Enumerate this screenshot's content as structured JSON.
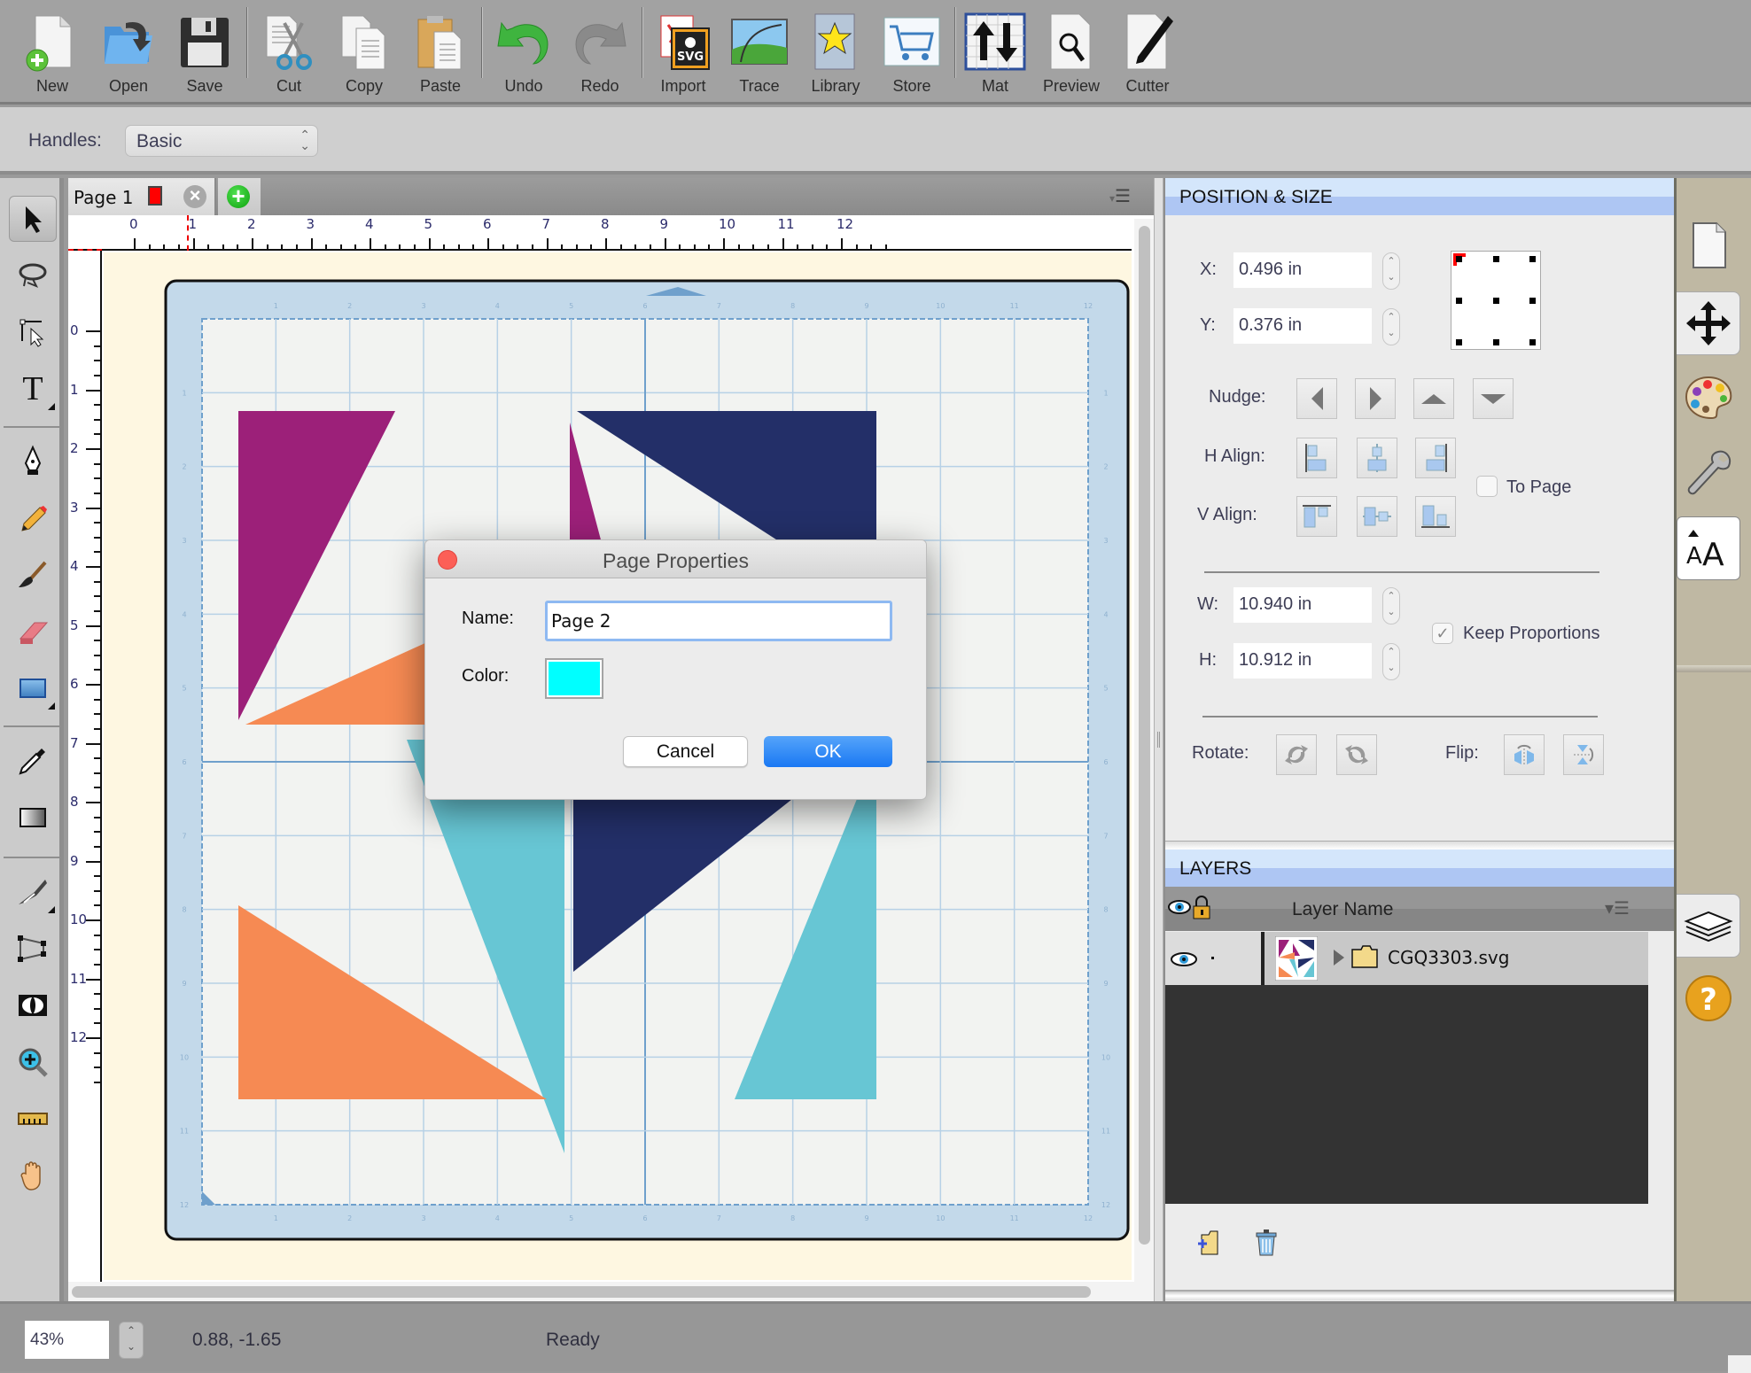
{
  "toolbar": {
    "buttons": [
      {
        "id": "new",
        "label": "New",
        "icon": "new-document-icon"
      },
      {
        "id": "open",
        "label": "Open",
        "icon": "open-folder-icon"
      },
      {
        "id": "save",
        "label": "Save",
        "icon": "floppy-disk-icon"
      },
      {
        "id": "cut",
        "label": "Cut",
        "icon": "scissors-icon"
      },
      {
        "id": "copy",
        "label": "Copy",
        "icon": "copy-icon"
      },
      {
        "id": "paste",
        "label": "Paste",
        "icon": "clipboard-icon"
      },
      {
        "id": "undo",
        "label": "Undo",
        "icon": "undo-arrow-icon"
      },
      {
        "id": "redo",
        "label": "Redo",
        "icon": "redo-arrow-icon"
      },
      {
        "id": "import",
        "label": "Import",
        "icon": "svg-import-icon"
      },
      {
        "id": "trace",
        "label": "Trace",
        "icon": "trace-image-icon"
      },
      {
        "id": "library",
        "label": "Library",
        "icon": "star-book-icon"
      },
      {
        "id": "store",
        "label": "Store",
        "icon": "shopping-cart-icon"
      },
      {
        "id": "mat",
        "label": "Mat",
        "icon": "mat-arrows-icon"
      },
      {
        "id": "preview",
        "label": "Preview",
        "icon": "magnifier-document-icon"
      },
      {
        "id": "cutter",
        "label": "Cutter",
        "icon": "blade-icon"
      }
    ],
    "import_badge": "SVG"
  },
  "handles": {
    "label": "Handles:",
    "value": "Basic"
  },
  "tools": [
    {
      "name": "select-tool",
      "selected": true
    },
    {
      "name": "lasso-tool"
    },
    {
      "name": "node-edit-tool"
    },
    {
      "name": "text-tool",
      "glyph": "T"
    },
    {
      "name": "pen-tool"
    },
    {
      "name": "pencil-tool"
    },
    {
      "name": "brush-tool"
    },
    {
      "name": "eraser-tool"
    },
    {
      "name": "rectangle-tool"
    },
    {
      "name": "eyedropper-tool"
    },
    {
      "name": "gradient-tool"
    },
    {
      "name": "knife-tool"
    },
    {
      "name": "distort-tool"
    },
    {
      "name": "weld-tool"
    },
    {
      "name": "zoom-tool"
    },
    {
      "name": "ruler-tool"
    },
    {
      "name": "hand-tool"
    }
  ],
  "document": {
    "page_tab_label": "Page 1",
    "page_tab_color": "#ff0000",
    "ruler_top_labels": [
      "0",
      "1",
      "2",
      "3",
      "4",
      "5",
      "6",
      "7",
      "8",
      "9",
      "10",
      "11",
      "12"
    ],
    "ruler_left_labels": [
      "0",
      "1",
      "2",
      "3",
      "4",
      "5",
      "6",
      "7",
      "8",
      "9",
      "10",
      "11",
      "12"
    ],
    "shape_colors": {
      "magenta": "#9c2079",
      "navy": "#232f68",
      "orange": "#f68a53",
      "teal": "#67c6d4"
    }
  },
  "position_size": {
    "header": "POSITION & SIZE",
    "x_label": "X:",
    "x_value": "0.496 in",
    "y_label": "Y:",
    "y_value": "0.376 in",
    "nudge_label": "Nudge:",
    "halign_label": "H Align:",
    "valign_label": "V Align:",
    "to_page_label": "To Page",
    "to_page_checked": false,
    "w_label": "W:",
    "w_value": "10.940 in",
    "h_label": "H:",
    "h_value": "10.912 in",
    "keep_proportions_label": "Keep Proportions",
    "keep_proportions_checked": true,
    "rotate_label": "Rotate:",
    "flip_label": "Flip:"
  },
  "layers": {
    "header": "LAYERS",
    "column_label": "Layer Name",
    "items": [
      {
        "name": "CGQ3303.svg",
        "visible": true,
        "type": "folder"
      }
    ]
  },
  "statusbar": {
    "zoom": "43%",
    "coords": "0.88, -1.65",
    "status": "Ready"
  },
  "dialog": {
    "title": "Page Properties",
    "name_label": "Name:",
    "name_value": "Page 2",
    "color_label": "Color:",
    "color_value": "#00ffff",
    "cancel_label": "Cancel",
    "ok_label": "OK"
  }
}
